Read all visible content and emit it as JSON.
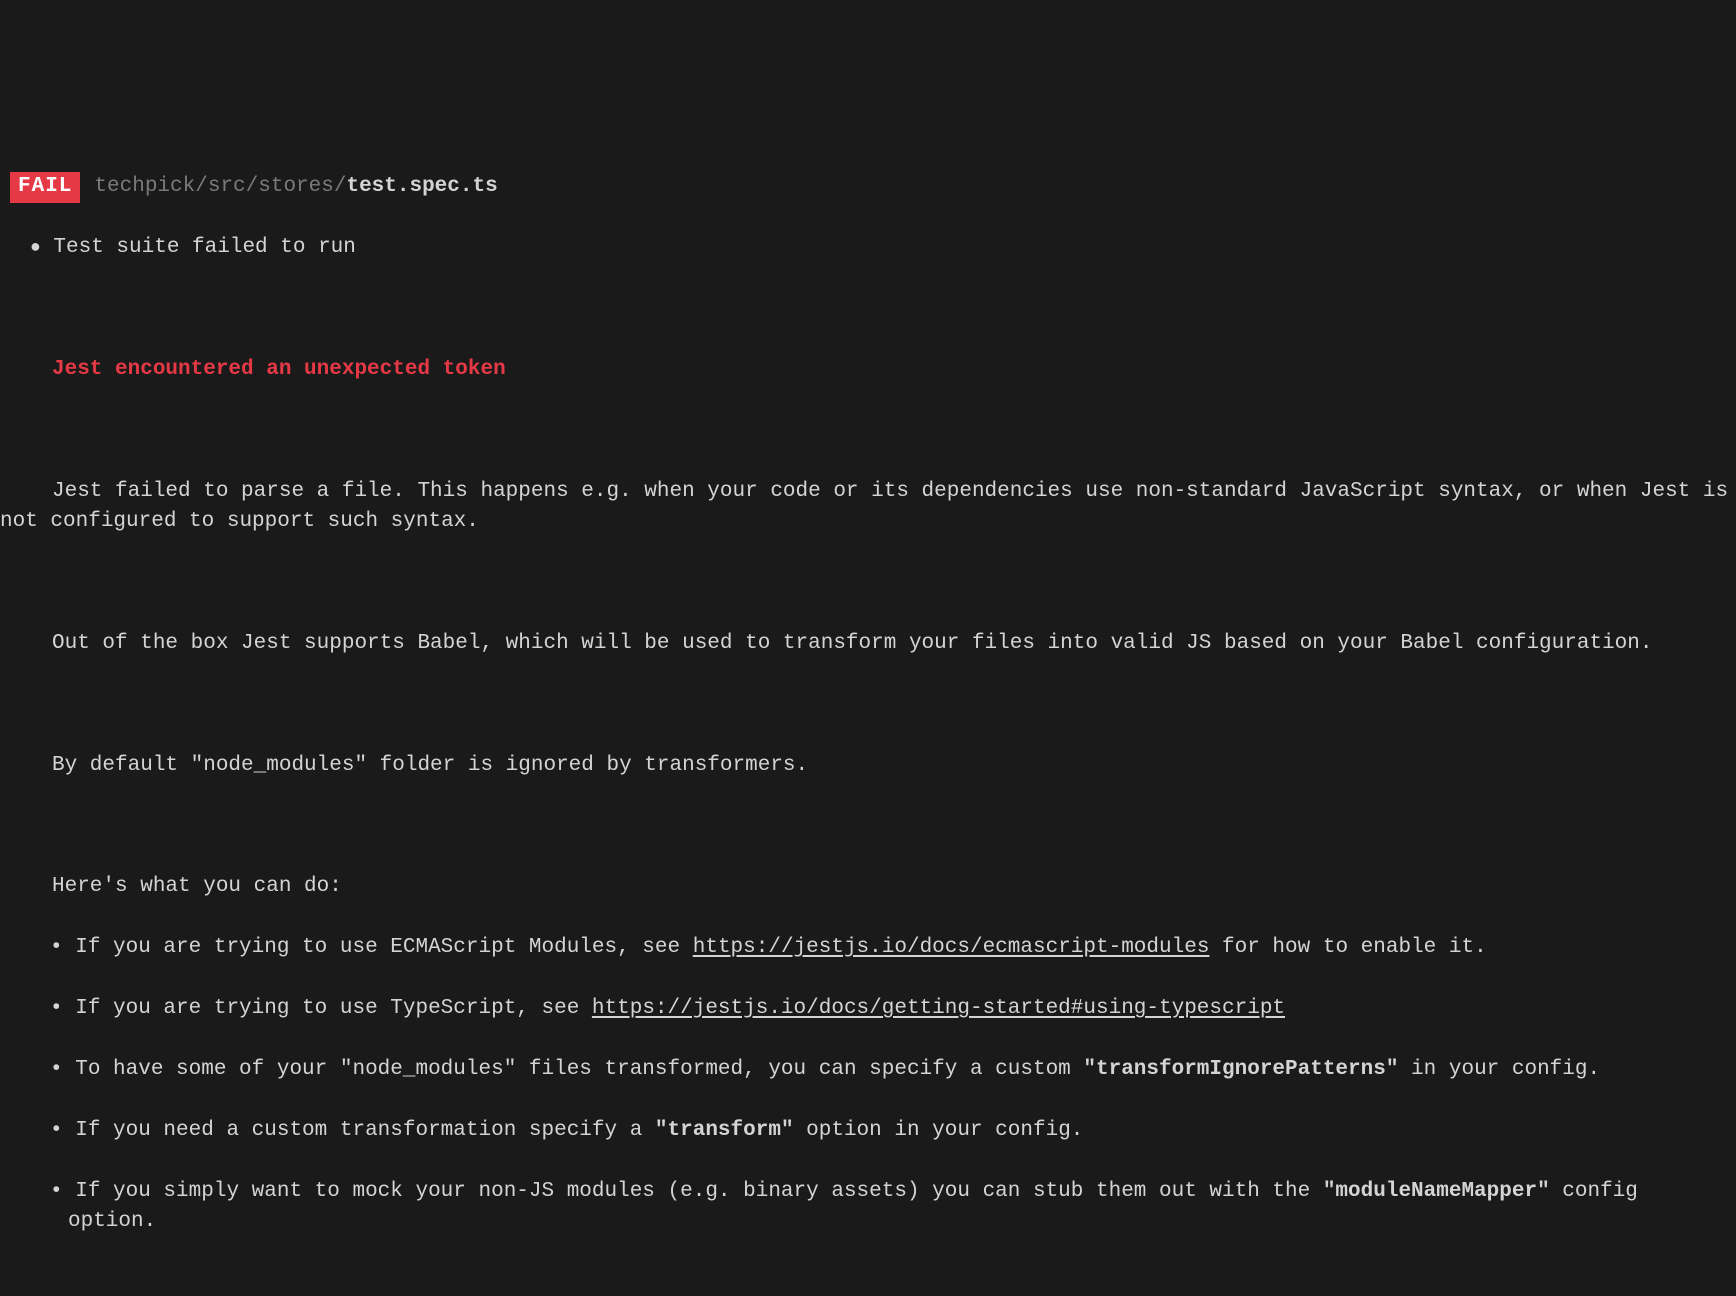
{
  "header": {
    "fail_label": "FAIL",
    "path_prefix": "techpick/src/stores/",
    "path_file": "test.spec.ts"
  },
  "suite_msg": "Test suite failed to run",
  "error_title": "Jest encountered an unexpected token",
  "para1": "Jest failed to parse a file. This happens e.g. when your code or its dependencies use non-standard JavaScript syntax, or when Jest is not configured to support such syntax.",
  "para2": "Out of the box Jest supports Babel, which will be used to transform your files into valid JS based on your Babel configuration.",
  "para3": "By default \"node_modules\" folder is ignored by transformers.",
  "options_intro": "Here's what you can do:",
  "bullets": {
    "b1_pre": "If you are trying to use ECMAScript Modules, see ",
    "b1_link": "https://jestjs.io/docs/ecmascript-modules",
    "b1_post": " for how to enable it.",
    "b2_pre": "If you are trying to use TypeScript, see ",
    "b2_link": "https://jestjs.io/docs/getting-started#using-typescript",
    "b3_pre": "To have some of your \"node_modules\" files transformed, you can specify a custom ",
    "b3_bold": "\"transformIgnorePatterns\"",
    "b3_post": " in your config.",
    "b4_pre": "If you need a custom transformation specify a ",
    "b4_bold": "\"transform\"",
    "b4_post": " option in your config.",
    "b5_pre": "If you simply want to mock your non-JS modules (e.g. binary assets) you can stub them out with the ",
    "b5_bold": "\"moduleNameMapper\"",
    "b5_post": " config option."
  }
}
